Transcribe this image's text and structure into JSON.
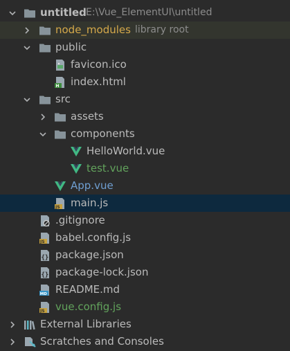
{
  "project_tree": {
    "root": {
      "name": "untitled",
      "path": "E:\\Vue_ElementUI\\untitled"
    },
    "node_modules": {
      "name": "node_modules",
      "hint": "library root"
    },
    "public": {
      "name": "public",
      "children": {
        "favicon": "favicon.ico",
        "index": "index.html"
      }
    },
    "src": {
      "name": "src",
      "assets": "assets",
      "components": {
        "name": "components",
        "hello": "HelloWorld.vue",
        "test": "test.vue"
      },
      "app": "App.vue",
      "main": "main.js"
    },
    "files": {
      "gitignore": ".gitignore",
      "babel": "babel.config.js",
      "package": "package.json",
      "package_lock": "package-lock.json",
      "readme": "README.md",
      "vue_config": "vue.config.js"
    },
    "external_libraries": "External Libraries",
    "scratches": "Scratches and Consoles"
  },
  "colors": {
    "background": "#2b2b2b",
    "selection": "#0d293e",
    "default_text": "#bbbbbb",
    "excluded_text": "#d5a94a",
    "modified_text": "#6f9fd2",
    "added_text": "#62a35c",
    "folder": "#87939a",
    "vue": "#41b883"
  },
  "icons": {
    "folder": "folder-icon",
    "excluded_folder": "excluded-folder-icon",
    "image_file": "image-file-icon",
    "html_file": "html-file-icon",
    "vue_file": "vue-logo-icon",
    "js_file": "javascript-file-icon",
    "ignore_file": "ignore-file-icon",
    "json_file": "json-file-icon",
    "markdown_file": "markdown-file-icon",
    "libraries": "external-libraries-icon",
    "scratches": "scratches-icon",
    "expanded": "chevron-down-icon",
    "collapsed": "chevron-right-icon"
  }
}
